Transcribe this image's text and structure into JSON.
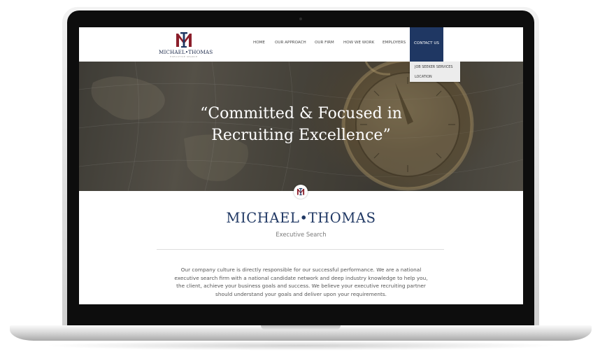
{
  "site": {
    "logo": {
      "name": "MICHAEL•THOMAS",
      "tagline": "EXECUTIVE SEARCH"
    },
    "nav": {
      "items": [
        {
          "label": "HOME"
        },
        {
          "label": "OUR APPROACH"
        },
        {
          "label": "OUR FIRM"
        },
        {
          "label": "HOW WE WORK"
        },
        {
          "label": "EMPLOYERS"
        },
        {
          "label": "CONTACT US"
        }
      ],
      "active_index": 5
    },
    "dropdown": {
      "items": [
        {
          "label": "JOB SEEKER SERVICES"
        },
        {
          "label": "LOCATION"
        }
      ]
    },
    "hero": {
      "heading_line1": "“Committed & Focused in",
      "heading_line2": "Recruiting Excellence”"
    },
    "brand": {
      "title": "MICHAEL•THOMAS",
      "subtitle": "Executive Search"
    },
    "body_text": "Our company culture is directly responsible for our successful performance. We are a national executive search firm with a national candidate network and deep industry knowledge to help you, the client, achieve your business goals and success. We believe your executive recruiting partner should understand your goals and deliver upon your requirements."
  },
  "colors": {
    "navy": "#1f3763",
    "maroon": "#8b1e2b",
    "text_gray": "#555555"
  },
  "icons": {
    "logo_mark": "mt-monogram-icon",
    "hero_badge": "mt-monogram-icon"
  }
}
